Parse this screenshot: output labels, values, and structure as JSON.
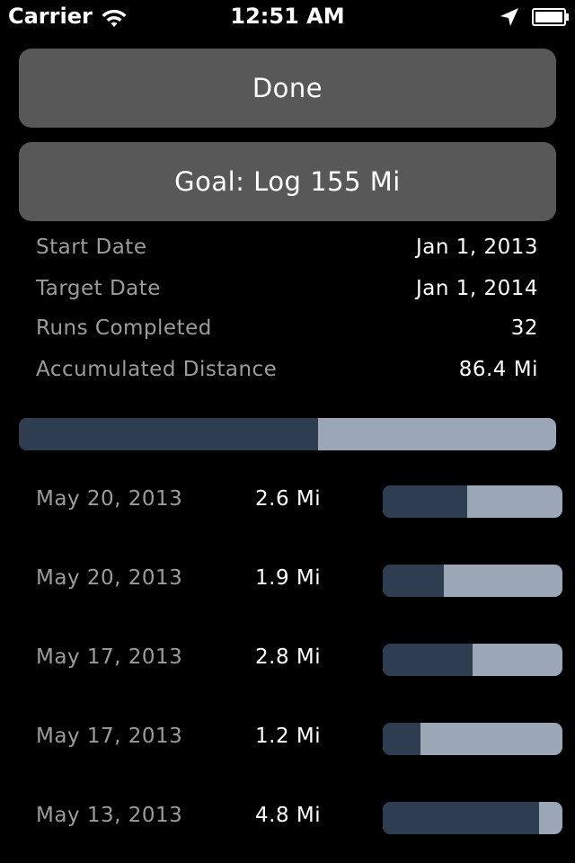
{
  "status_bar": {
    "carrier": "Carrier",
    "time": "12:51 AM"
  },
  "buttons": {
    "done_label": "Done",
    "goal_label": "Goal: Log 155 Mi"
  },
  "info": [
    {
      "label": "Start Date",
      "value": "Jan 1, 2013"
    },
    {
      "label": "Target Date",
      "value": "Jan 1, 2014"
    },
    {
      "label": "Runs Completed",
      "value": "32"
    },
    {
      "label": "Accumulated Distance",
      "value": "86.4 Mi"
    }
  ],
  "overall_progress": 0.557,
  "runs": [
    {
      "date": "May 20, 2013",
      "distance": "2.6 Mi",
      "progress": 0.47
    },
    {
      "date": "May 20, 2013",
      "distance": "1.9 Mi",
      "progress": 0.34
    },
    {
      "date": "May 17, 2013",
      "distance": "2.8 Mi",
      "progress": 0.5
    },
    {
      "date": "May 17, 2013",
      "distance": "1.2 Mi",
      "progress": 0.21
    },
    {
      "date": "May 13, 2013",
      "distance": "4.8 Mi",
      "progress": 0.87
    }
  ],
  "colors": {
    "background": "#000000",
    "button": "#585858",
    "bar_track": "#9ba7b6",
    "bar_fill": "#2e3d4f",
    "label_gray": "#9c9c9c"
  },
  "icons": {
    "wifi": "wifi-icon",
    "location": "location-arrow-icon",
    "battery": "battery-icon"
  }
}
